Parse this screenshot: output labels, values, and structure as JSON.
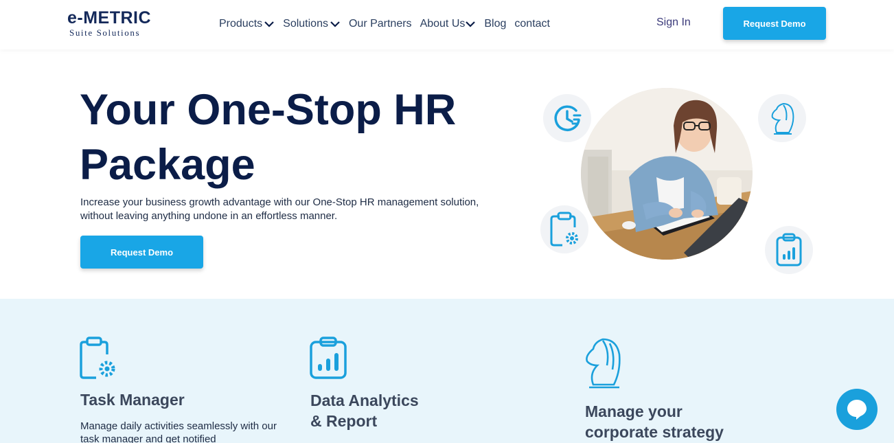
{
  "brand": {
    "logo_main": "e-METRIC",
    "logo_sub": "Suite Solutions",
    "accent": "#19a6e6",
    "navy": "#0b1d48"
  },
  "nav": {
    "items": [
      {
        "label": "Products",
        "has_dropdown": true
      },
      {
        "label": "Solutions",
        "has_dropdown": true
      },
      {
        "label": "Our Partners",
        "has_dropdown": false
      },
      {
        "label": "About Us",
        "has_dropdown": true
      },
      {
        "label": "Blog",
        "has_dropdown": false
      },
      {
        "label": "contact",
        "has_dropdown": false
      }
    ],
    "sign_in": "Sign In",
    "request_demo": "Request Demo"
  },
  "hero": {
    "title_line1": "Your One-Stop HR",
    "title_line2": "Package",
    "description": "Increase your business growth advantage with our One-Stop HR management solution, without leaving anything undone in an effortless manner.",
    "cta": "Request Demo",
    "icons": [
      "clock-icon",
      "chess-knight-icon",
      "clipboard-gear-icon",
      "clipboard-chart-icon"
    ]
  },
  "features": [
    {
      "icon": "clipboard-gear-icon",
      "title_line1": "Task Manager",
      "title_line2": "",
      "description": "Manage daily activities seamlessly with our task manager and get notified"
    },
    {
      "icon": "clipboard-chart-icon",
      "title_line1": "Data Analytics",
      "title_line2": "& Report",
      "description": ""
    },
    {
      "icon": "chess-knight-icon",
      "title_line1": "Manage your",
      "title_line2": "corporate strategy",
      "description": ""
    }
  ],
  "chat": {
    "icon": "chat-icon"
  }
}
